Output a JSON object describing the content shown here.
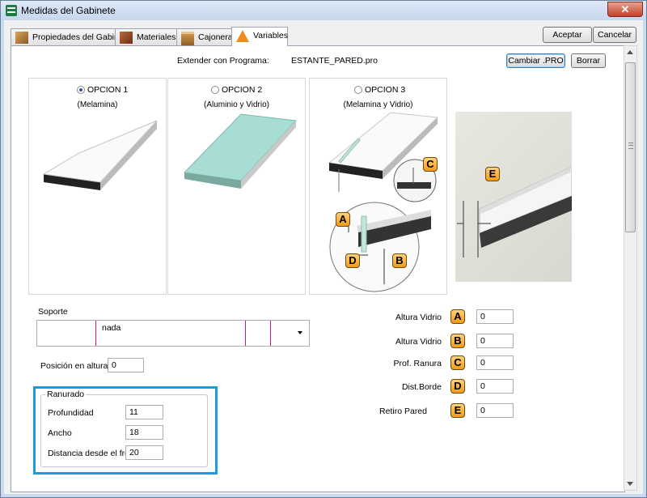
{
  "window": {
    "title": "Medidas del Gabinete",
    "close_label": "✕"
  },
  "tabs": [
    {
      "label": "Propiedades del Gabinete",
      "icon": "cabinet-box-icon",
      "active": false
    },
    {
      "label": "Materiales",
      "icon": "materials-icon",
      "active": false
    },
    {
      "label": "Cajoneras",
      "icon": "drawer-icon",
      "active": false
    },
    {
      "label": "Variables",
      "icon": "cone-icon",
      "active": true
    }
  ],
  "buttons": {
    "accept": "Aceptar",
    "cancel": "Cancelar",
    "change_pro": "Cambiar .PRO",
    "delete": "Borrar"
  },
  "program": {
    "label": "Extender con Programa:",
    "value": "ESTANTE_PARED.pro"
  },
  "options": [
    {
      "title": "OPCION 1",
      "subtitle": "(Melamina)",
      "selected": true
    },
    {
      "title": "OPCION 2",
      "subtitle": "(Aluminio y Vidrio)",
      "selected": false
    },
    {
      "title": "OPCION 3",
      "subtitle": "(Melamina y Vidrio)",
      "selected": false
    }
  ],
  "diagram_labels": {
    "a": "A",
    "b": "B",
    "c": "C",
    "d": "D",
    "e": "E"
  },
  "soporte": {
    "label": "Soporte",
    "value": "nada"
  },
  "posicion": {
    "label": "Posición en altura",
    "value": "0"
  },
  "ranurado": {
    "title": "Ranurado",
    "profundidad": {
      "label": "Profundidad",
      "value": "11"
    },
    "ancho": {
      "label": "Ancho",
      "value": "18"
    },
    "distancia": {
      "label": "Distancia desde el frente",
      "value": "20"
    }
  },
  "variables": [
    {
      "label": "Altura Vidrio",
      "badge": "A",
      "value": "0"
    },
    {
      "label": "Altura Vidrio",
      "badge": "B",
      "value": "0"
    },
    {
      "label": "Prof. Ranura",
      "badge": "C",
      "value": "0"
    },
    {
      "label": "Dist.Borde",
      "badge": "D",
      "value": "0"
    },
    {
      "label": "Retiro Pared",
      "badge": "E",
      "value": "0"
    }
  ],
  "colors": {
    "highlight": "#1d9be0",
    "badge": "#f5a21d",
    "glass": "#a7ddd4",
    "scrollbar_mark": "#c0208a"
  }
}
